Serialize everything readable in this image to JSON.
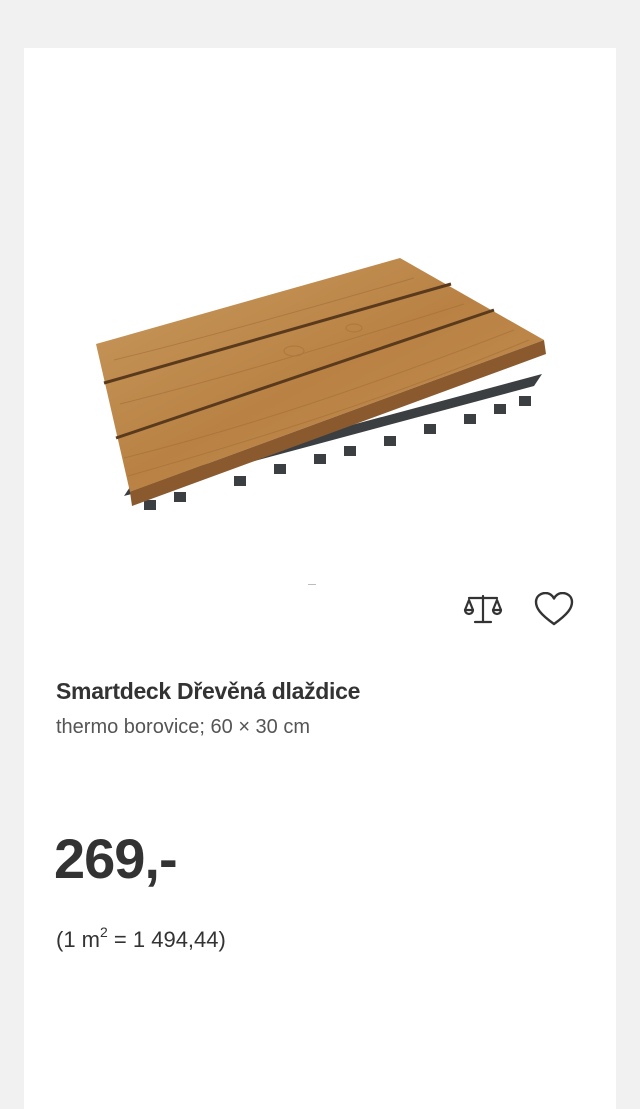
{
  "product": {
    "image_alt": "wood-deck-tile-image",
    "title": "Smartdeck Dřevěná dlaždice",
    "subtitle": "thermo borovice; 60 × 30 cm",
    "price": "269,-",
    "unit_price": {
      "open": "(1 m",
      "exponent": "2",
      "rest": " = 1 494,44)"
    }
  },
  "actions": {
    "compare_icon": "scale-icon",
    "wishlist_icon": "heart-icon"
  },
  "colors": {
    "card_background": "#ffffff",
    "page_background": "#f1f1f1",
    "text": "#333333",
    "wood": "#c08a4e",
    "base": "#3c3f42"
  }
}
